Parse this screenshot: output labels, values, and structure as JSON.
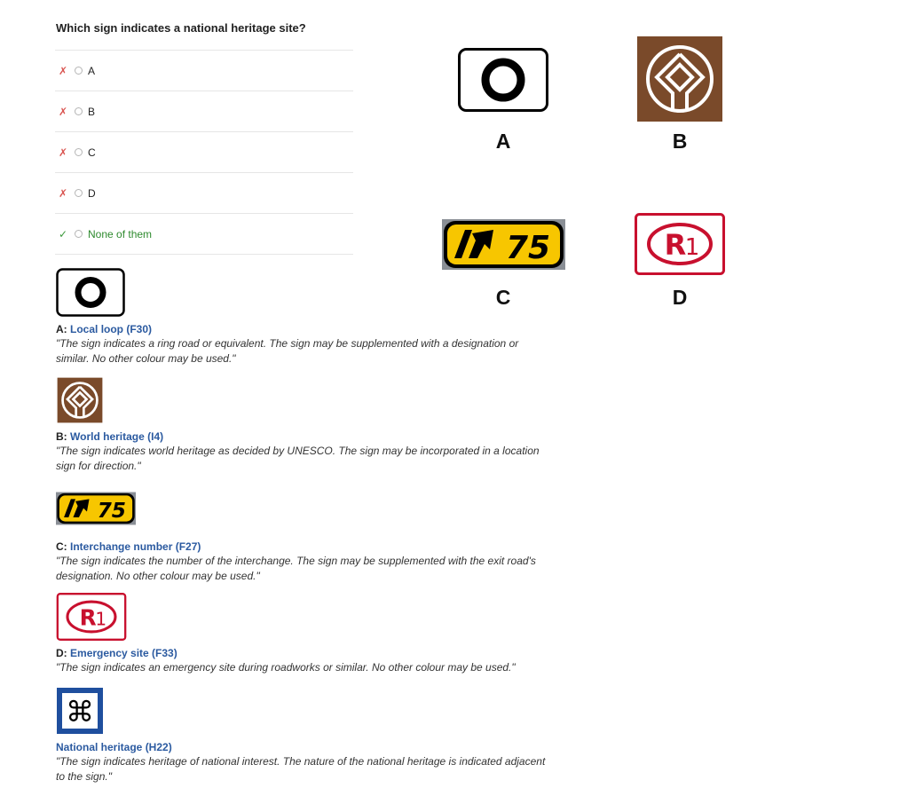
{
  "question": "Which sign indicates a national heritage site?",
  "options": [
    {
      "mark": "✗",
      "label": "A"
    },
    {
      "mark": "✗",
      "label": "B"
    },
    {
      "mark": "✗",
      "label": "C"
    },
    {
      "mark": "✗",
      "label": "D"
    },
    {
      "mark": "✓",
      "label": "None of them"
    }
  ],
  "signs": {
    "a": {
      "letter": "A"
    },
    "b": {
      "letter": "B"
    },
    "c": {
      "letter": "C",
      "number": "75"
    },
    "d": {
      "letter": "D",
      "code": "R",
      "sub": "1"
    },
    "national": {
      "glyph": "⌘"
    }
  },
  "explanations": [
    {
      "prefix": "A:",
      "link": "Local loop (F30)",
      "quote": "\"The sign indicates a ring road or equivalent. The sign may be supplemented with a designation or similar. No other colour may be used.\""
    },
    {
      "prefix": "B:",
      "link": "World heritage (I4)",
      "quote": "\"The sign indicates world heritage as decided by UNESCO. The sign may be incorporated in a location sign for direction.\""
    },
    {
      "prefix": "C:",
      "link": "Interchange number (F27)",
      "quote": "\"The sign indicates the number of the interchange. The sign may be supplemented with the exit road's designation. No other colour may be used.\""
    },
    {
      "prefix": "D:",
      "link": "Emergency site (F33)",
      "quote": "\"The sign indicates an emergency site during roadworks or similar. No other colour may be used.\""
    },
    {
      "prefix": "",
      "link": "National heritage (H22)",
      "quote": "\"The sign indicates heritage of national interest. The nature of the national heritage is indicated adjacent to the sign.\""
    }
  ],
  "colors": {
    "wrong": "#d9534f",
    "correct": "#2e8a2e",
    "link": "#2b5aa0",
    "heritage_brown": "#7a4a2a",
    "interchange_yellow": "#f7c600",
    "emergency_red": "#c8102e",
    "national_blue": "#1f4f9e"
  }
}
